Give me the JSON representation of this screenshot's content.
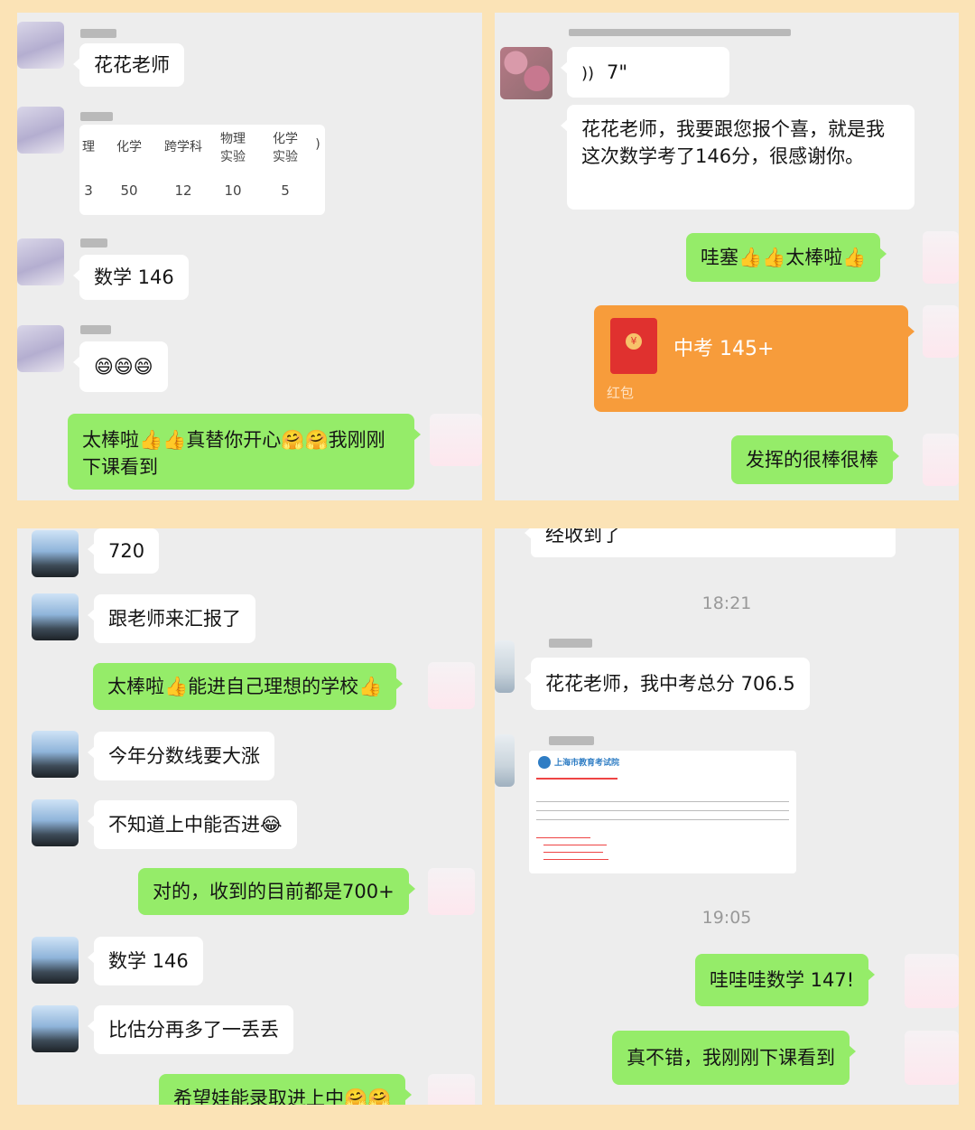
{
  "panel1": {
    "messages": {
      "m1": "花花老师",
      "m3": "数学 146",
      "m4": "😄😄😄",
      "m5": "太棒啦👍👍真替你开心🤗🤗我刚刚下课看到"
    },
    "score_table": {
      "headers": [
        "理",
        "化学",
        "跨学科",
        "物理\n实验",
        "化学\n实验",
        ")"
      ],
      "values": [
        "3",
        "50",
        "12",
        "10",
        "5",
        ""
      ]
    }
  },
  "panel2": {
    "voice": "7\"",
    "m1": "花花老师，我要跟您报个喜，就是我这次数学考了146分，很感谢你。",
    "m2": "哇塞👍👍太棒啦👍",
    "red_packet": {
      "title": "中考 145+",
      "label": "红包"
    },
    "m3": "发挥的很棒很棒"
  },
  "panel3": {
    "m1": "720",
    "m2": "跟老师来汇报了",
    "m3": "太棒啦👍能进自己理想的学校👍",
    "m4": "今年分数线要大涨",
    "m5": "不知道上中能否进😂",
    "m6": "对的，收到的目前都是700+",
    "m7": "数学 146",
    "m8": "比估分再多了一丢丢",
    "m9": "希望娃能录取进上中🤗🤗"
  },
  "panel4": {
    "m0": "经收到了",
    "time1": "18:21",
    "m1": "花花老师，我中考总分 706.5",
    "doc_header": "上海市教育考试院",
    "time2": "19:05",
    "m2": "哇哇哇数学 147!",
    "m3": "真不错，我刚刚下课看到"
  },
  "colors": {
    "page_bg": "#fbe3b6",
    "chat_bg": "#ededed",
    "self_bubble": "#95ec69",
    "other_bubble": "#ffffff",
    "red_packet": "#f79c3b"
  },
  "icons": [
    "voice-icon",
    "red-envelope-icon"
  ]
}
